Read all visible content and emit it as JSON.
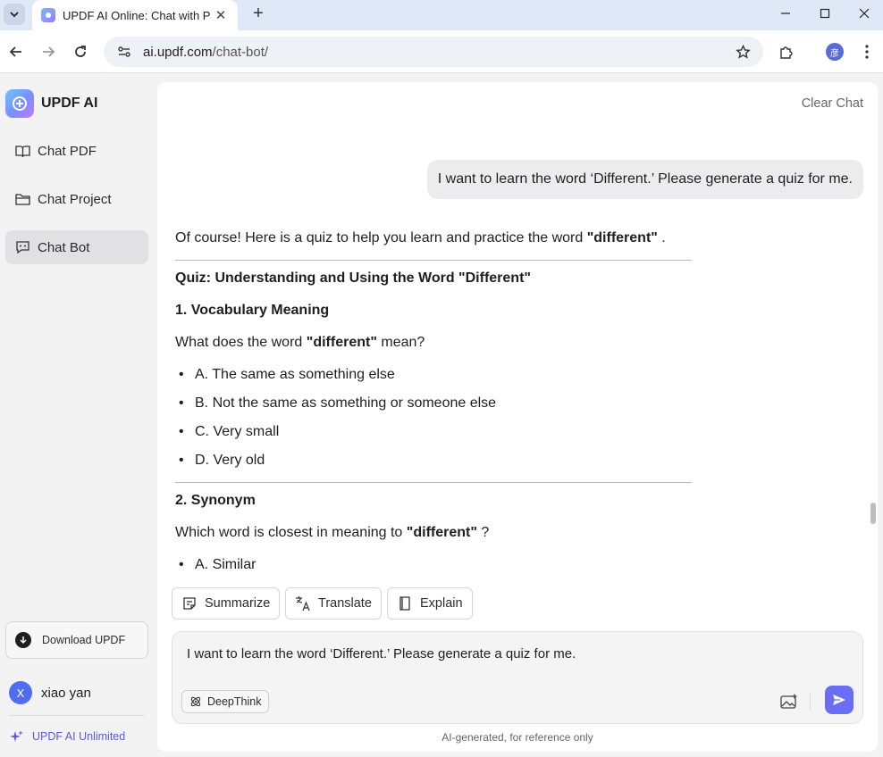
{
  "browser": {
    "tab_title": "UPDF AI Online: Chat with PDF",
    "url_domain": "ai.updf.com",
    "url_path": "/chat-bot/",
    "profile_initial": "彦"
  },
  "sidebar": {
    "brand": "UPDF AI",
    "items": [
      {
        "label": "Chat PDF",
        "icon": "book-open-icon",
        "active": false
      },
      {
        "label": "Chat Project",
        "icon": "folder-icon",
        "active": false
      },
      {
        "label": "Chat Bot",
        "icon": "chat-bot-icon",
        "active": true
      }
    ],
    "download_label": "Download UPDF",
    "user": {
      "initial": "X",
      "name": "xiao yan"
    },
    "unlimited_label": "UPDF AI Unlimited"
  },
  "chat": {
    "clear_label": "Clear Chat",
    "user_message": "I want to learn the word ‘Different.’ Please generate a quiz for me.",
    "answer": {
      "intro": "Of course! Here is a quiz to help you learn and practice the word ",
      "intro_bold": "\"different\"",
      "intro_end": " .",
      "title": "Quiz: Understanding and Using the Word \"Different\"",
      "q1_heading": "1. Vocabulary Meaning",
      "q1_text": "What does the word ",
      "q1_bold": "\"different\"",
      "q1_end": " mean?",
      "q1_options": [
        "A. The same as something else",
        "B. Not the same as something or someone else",
        "C. Very small",
        "D. Very old"
      ],
      "q2_heading": "2. Synonym",
      "q2_text": "Which word is closest in meaning to ",
      "q2_bold": "\"different\"",
      "q2_end": " ?",
      "q2_options": [
        "A. Similar"
      ]
    },
    "quick_actions": {
      "summarize": "Summarize",
      "translate": "Translate",
      "explain": "Explain"
    },
    "composer": {
      "input_value": "I want to learn the word ‘Different.’ Please generate a quiz for me.",
      "deepthink_label": "DeepThink"
    },
    "disclaimer": "AI-generated, for reference only"
  },
  "colors": {
    "accent": "#6a6ef4",
    "brand_link": "#5b5bd6",
    "avatar": "#4f6df0"
  }
}
